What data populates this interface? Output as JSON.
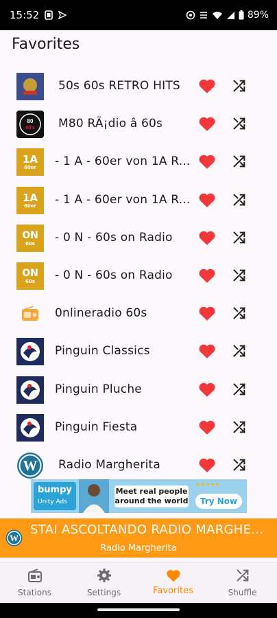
{
  "status": {
    "time": "15:52",
    "battery": "89%"
  },
  "page": {
    "title": "Favorites"
  },
  "stations": [
    {
      "name": "50s 60s RETRO HITS",
      "logo": "retro-logo",
      "indent": true
    },
    {
      "name": "M80 RÃ¡dio â 60s",
      "logo": "m80-logo",
      "indent": true
    },
    {
      "name": "- 1 A - 60er von 1A R...",
      "logo": "1a-logo",
      "indent": false
    },
    {
      "name": "- 1 A - 60er von 1A R...",
      "logo": "1a-logo",
      "indent": false
    },
    {
      "name": "- 0 N - 60s on Radio",
      "logo": "on-logo",
      "indent": false
    },
    {
      "name": "- 0 N - 60s on Radio",
      "logo": "on-logo",
      "indent": false
    },
    {
      "name": "0nlineradio 60s",
      "logo": "radio-logo",
      "indent": false
    },
    {
      "name": "Pinguin Classics",
      "logo": "pinguin-logo",
      "indent": false
    },
    {
      "name": "Pinguin Pluche",
      "logo": "pinguin-logo",
      "indent": false
    },
    {
      "name": "Pinguin Fiesta",
      "logo": "pinguin-logo",
      "indent": false
    },
    {
      "name": "Radio Margherita",
      "logo": "wordpress-logo",
      "indent": true
    }
  ],
  "logo_text": {
    "one_a": "1A",
    "one_a_sub": "60er",
    "on": "ON",
    "on_sub": "60s",
    "m80": "80",
    "m80_sub": "60's"
  },
  "ad": {
    "brand": "bumpy",
    "sponsor": "Unity Ads",
    "headline": "Meet real people around the world",
    "cta": "Try Now",
    "rating": "★★★★★"
  },
  "now_playing": {
    "title": "STAI ASCOLTANDO RADIO MARGHE...",
    "station": "Radio Margherita"
  },
  "nav": [
    {
      "label": "Stations",
      "icon": "radio-icon",
      "active": false
    },
    {
      "label": "Settings",
      "icon": "gear-icon",
      "active": false
    },
    {
      "label": "Favorites",
      "icon": "heart-icon",
      "active": true
    },
    {
      "label": "Shuffle",
      "icon": "shuffle-icon",
      "active": false
    }
  ],
  "colors": {
    "accent": "#ff9a17",
    "heart": "#f2383b",
    "active_tab": "#ff8a00"
  }
}
